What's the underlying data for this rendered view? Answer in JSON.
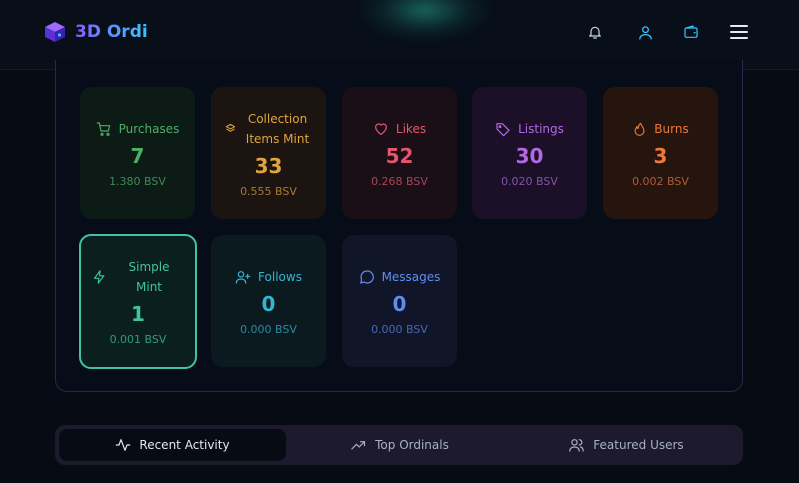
{
  "brand": {
    "name": "3D Ordi"
  },
  "header": {
    "icons": [
      "bell-icon",
      "user-icon",
      "wallet-icon",
      "menu-icon"
    ]
  },
  "stats": [
    {
      "label": "Purchases",
      "count": "7",
      "bsv": "1.380 BSV",
      "icon": "shopping-cart-icon",
      "color": "#4caf66",
      "bg": "#0d1b17"
    },
    {
      "label": "Collection Items Mint",
      "count": "33",
      "bsv": "0.555 BSV",
      "icon": "layers-icon",
      "color": "#e0a43d",
      "bg": "#1b1411"
    },
    {
      "label": "Likes",
      "count": "52",
      "bsv": "0.268 BSV",
      "icon": "heart-icon",
      "color": "#e4566b",
      "bg": "#1a0f16"
    },
    {
      "label": "Listings",
      "count": "30",
      "bsv": "0.020 BSV",
      "icon": "tag-icon",
      "color": "#b468e8",
      "bg": "#1b1027"
    },
    {
      "label": "Burns",
      "count": "3",
      "bsv": "0.002 BSV",
      "icon": "flame-icon",
      "color": "#ec7a3a",
      "bg": "#26140f"
    },
    {
      "label": "Simple Mint",
      "count": "1",
      "bsv": "0.001 BSV",
      "icon": "lightning-icon",
      "color": "#3ec4a4",
      "bg": "#0c1f1f"
    },
    {
      "label": "Follows",
      "count": "0",
      "bsv": "0.000 BSV",
      "icon": "user-plus-icon",
      "color": "#36b4d4",
      "bg": "#0b1a1e"
    },
    {
      "label": "Messages",
      "count": "0",
      "bsv": "0.000 BSV",
      "icon": "message-icon",
      "color": "#5e8ef0",
      "bg": "#111528"
    }
  ],
  "tabs": [
    {
      "label": "Recent Activity",
      "icon": "activity-icon",
      "active": true
    },
    {
      "label": "Top Ordinals",
      "icon": "trending-up-icon",
      "active": false
    },
    {
      "label": "Featured Users",
      "icon": "users-icon",
      "active": false
    }
  ]
}
